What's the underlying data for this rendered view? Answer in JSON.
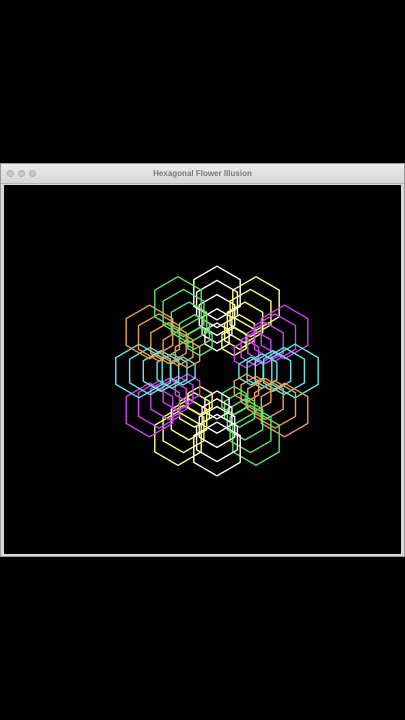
{
  "window": {
    "title": "Hexagonal Flower Illusion"
  },
  "colors": {
    "background": "#000000",
    "palette": [
      "#ffffff",
      "#ffff80",
      "#cc44ee",
      "#66e6e6",
      "#e8a050",
      "#66e066"
    ]
  },
  "flower": {
    "petals": 12,
    "hexagons_per_petal": 5
  }
}
